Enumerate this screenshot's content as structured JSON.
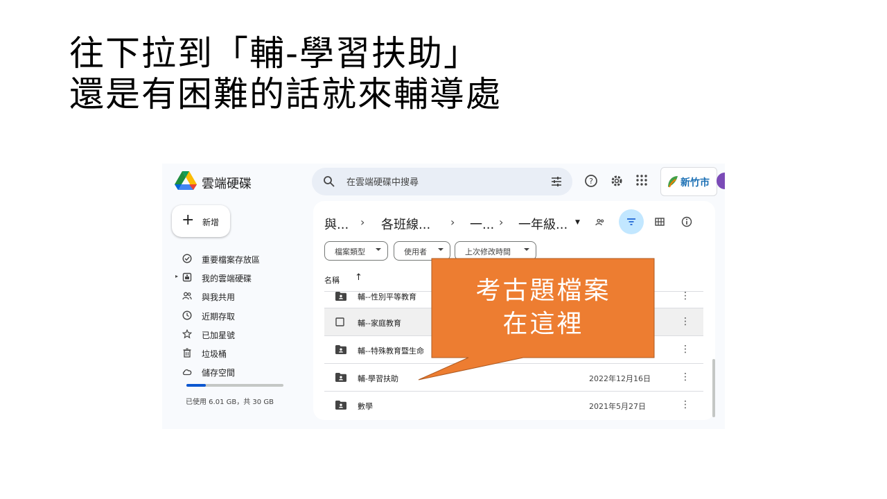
{
  "slide": {
    "title_line1": "往下拉到「輔-學習扶助」",
    "title_line2": "還是有困難的話就來輔導處"
  },
  "header": {
    "app_name": "雲端硬碟",
    "search_placeholder": "在雲端硬碟中搜尋",
    "org_badge": "新竹市"
  },
  "sidebar": {
    "new_label": "新增",
    "items": [
      {
        "label": "重要檔案存放區",
        "icon": "priority-icon"
      },
      {
        "label": "我的雲端硬碟",
        "icon": "my-drive-icon"
      },
      {
        "label": "與我共用",
        "icon": "shared-icon"
      },
      {
        "label": "近期存取",
        "icon": "clock-icon"
      },
      {
        "label": "已加星號",
        "icon": "star-icon"
      },
      {
        "label": "垃圾桶",
        "icon": "trash-icon"
      },
      {
        "label": "儲存空間",
        "icon": "cloud-icon"
      }
    ],
    "storage_used_fraction": 0.2,
    "storage_text": "已使用 6.01 GB，共 30 GB"
  },
  "breadcrumb": [
    "與...",
    "各班線...",
    "一...",
    "一年級..."
  ],
  "filters": [
    "檔案類型",
    "使用者",
    "上次修改時間"
  ],
  "list": {
    "col_name": "名稱",
    "sort_arrow": "↑",
    "rows": [
      {
        "name": "輔--性別平等教育",
        "date": ""
      },
      {
        "name": "輔--家庭教育",
        "date": ""
      },
      {
        "name": "輔--特殊教育暨生命",
        "date": ""
      },
      {
        "name": "輔-學習扶助",
        "date": "2022年12月16日"
      },
      {
        "name": "數學",
        "date": "2021年5月27日"
      }
    ]
  },
  "callout": {
    "line1": "考古題檔案",
    "line2": "在這裡",
    "color": "#ed7d31"
  }
}
